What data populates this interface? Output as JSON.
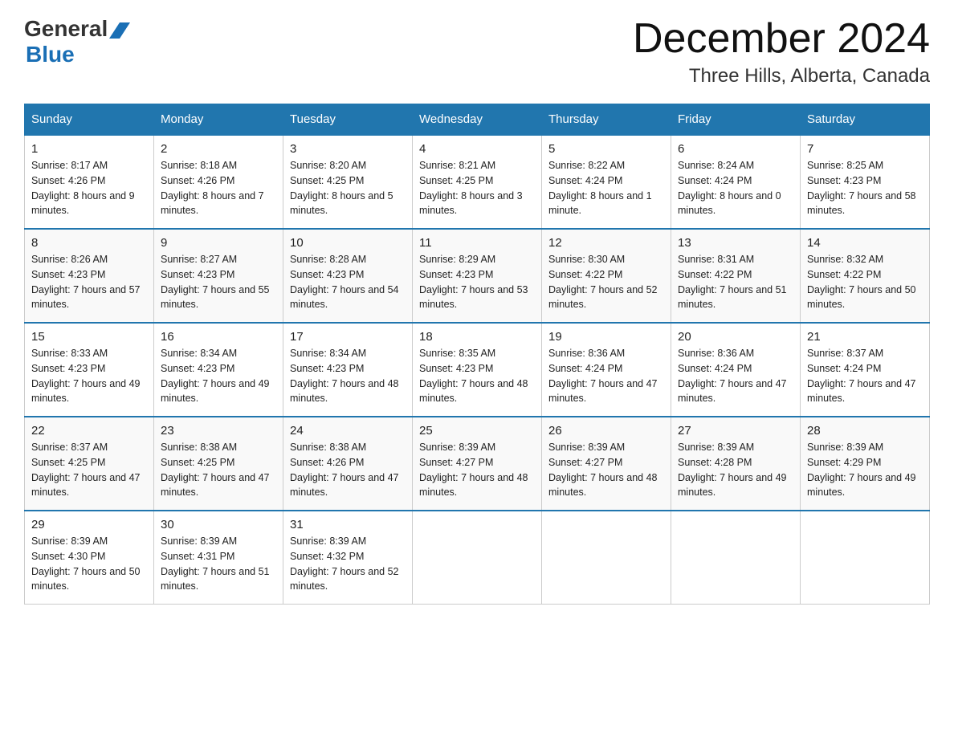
{
  "header": {
    "logo_general": "General",
    "logo_blue": "Blue",
    "month_title": "December 2024",
    "location": "Three Hills, Alberta, Canada"
  },
  "days_of_week": [
    "Sunday",
    "Monday",
    "Tuesday",
    "Wednesday",
    "Thursday",
    "Friday",
    "Saturday"
  ],
  "weeks": [
    [
      {
        "day": "1",
        "sunrise": "8:17 AM",
        "sunset": "4:26 PM",
        "daylight": "8 hours and 9 minutes."
      },
      {
        "day": "2",
        "sunrise": "8:18 AM",
        "sunset": "4:26 PM",
        "daylight": "8 hours and 7 minutes."
      },
      {
        "day": "3",
        "sunrise": "8:20 AM",
        "sunset": "4:25 PM",
        "daylight": "8 hours and 5 minutes."
      },
      {
        "day": "4",
        "sunrise": "8:21 AM",
        "sunset": "4:25 PM",
        "daylight": "8 hours and 3 minutes."
      },
      {
        "day": "5",
        "sunrise": "8:22 AM",
        "sunset": "4:24 PM",
        "daylight": "8 hours and 1 minute."
      },
      {
        "day": "6",
        "sunrise": "8:24 AM",
        "sunset": "4:24 PM",
        "daylight": "8 hours and 0 minutes."
      },
      {
        "day": "7",
        "sunrise": "8:25 AM",
        "sunset": "4:23 PM",
        "daylight": "7 hours and 58 minutes."
      }
    ],
    [
      {
        "day": "8",
        "sunrise": "8:26 AM",
        "sunset": "4:23 PM",
        "daylight": "7 hours and 57 minutes."
      },
      {
        "day": "9",
        "sunrise": "8:27 AM",
        "sunset": "4:23 PM",
        "daylight": "7 hours and 55 minutes."
      },
      {
        "day": "10",
        "sunrise": "8:28 AM",
        "sunset": "4:23 PM",
        "daylight": "7 hours and 54 minutes."
      },
      {
        "day": "11",
        "sunrise": "8:29 AM",
        "sunset": "4:23 PM",
        "daylight": "7 hours and 53 minutes."
      },
      {
        "day": "12",
        "sunrise": "8:30 AM",
        "sunset": "4:22 PM",
        "daylight": "7 hours and 52 minutes."
      },
      {
        "day": "13",
        "sunrise": "8:31 AM",
        "sunset": "4:22 PM",
        "daylight": "7 hours and 51 minutes."
      },
      {
        "day": "14",
        "sunrise": "8:32 AM",
        "sunset": "4:22 PM",
        "daylight": "7 hours and 50 minutes."
      }
    ],
    [
      {
        "day": "15",
        "sunrise": "8:33 AM",
        "sunset": "4:23 PM",
        "daylight": "7 hours and 49 minutes."
      },
      {
        "day": "16",
        "sunrise": "8:34 AM",
        "sunset": "4:23 PM",
        "daylight": "7 hours and 49 minutes."
      },
      {
        "day": "17",
        "sunrise": "8:34 AM",
        "sunset": "4:23 PM",
        "daylight": "7 hours and 48 minutes."
      },
      {
        "day": "18",
        "sunrise": "8:35 AM",
        "sunset": "4:23 PM",
        "daylight": "7 hours and 48 minutes."
      },
      {
        "day": "19",
        "sunrise": "8:36 AM",
        "sunset": "4:24 PM",
        "daylight": "7 hours and 47 minutes."
      },
      {
        "day": "20",
        "sunrise": "8:36 AM",
        "sunset": "4:24 PM",
        "daylight": "7 hours and 47 minutes."
      },
      {
        "day": "21",
        "sunrise": "8:37 AM",
        "sunset": "4:24 PM",
        "daylight": "7 hours and 47 minutes."
      }
    ],
    [
      {
        "day": "22",
        "sunrise": "8:37 AM",
        "sunset": "4:25 PM",
        "daylight": "7 hours and 47 minutes."
      },
      {
        "day": "23",
        "sunrise": "8:38 AM",
        "sunset": "4:25 PM",
        "daylight": "7 hours and 47 minutes."
      },
      {
        "day": "24",
        "sunrise": "8:38 AM",
        "sunset": "4:26 PM",
        "daylight": "7 hours and 47 minutes."
      },
      {
        "day": "25",
        "sunrise": "8:39 AM",
        "sunset": "4:27 PM",
        "daylight": "7 hours and 48 minutes."
      },
      {
        "day": "26",
        "sunrise": "8:39 AM",
        "sunset": "4:27 PM",
        "daylight": "7 hours and 48 minutes."
      },
      {
        "day": "27",
        "sunrise": "8:39 AM",
        "sunset": "4:28 PM",
        "daylight": "7 hours and 49 minutes."
      },
      {
        "day": "28",
        "sunrise": "8:39 AM",
        "sunset": "4:29 PM",
        "daylight": "7 hours and 49 minutes."
      }
    ],
    [
      {
        "day": "29",
        "sunrise": "8:39 AM",
        "sunset": "4:30 PM",
        "daylight": "7 hours and 50 minutes."
      },
      {
        "day": "30",
        "sunrise": "8:39 AM",
        "sunset": "4:31 PM",
        "daylight": "7 hours and 51 minutes."
      },
      {
        "day": "31",
        "sunrise": "8:39 AM",
        "sunset": "4:32 PM",
        "daylight": "7 hours and 52 minutes."
      },
      null,
      null,
      null,
      null
    ]
  ],
  "labels": {
    "sunrise": "Sunrise:",
    "sunset": "Sunset:",
    "daylight": "Daylight:"
  }
}
